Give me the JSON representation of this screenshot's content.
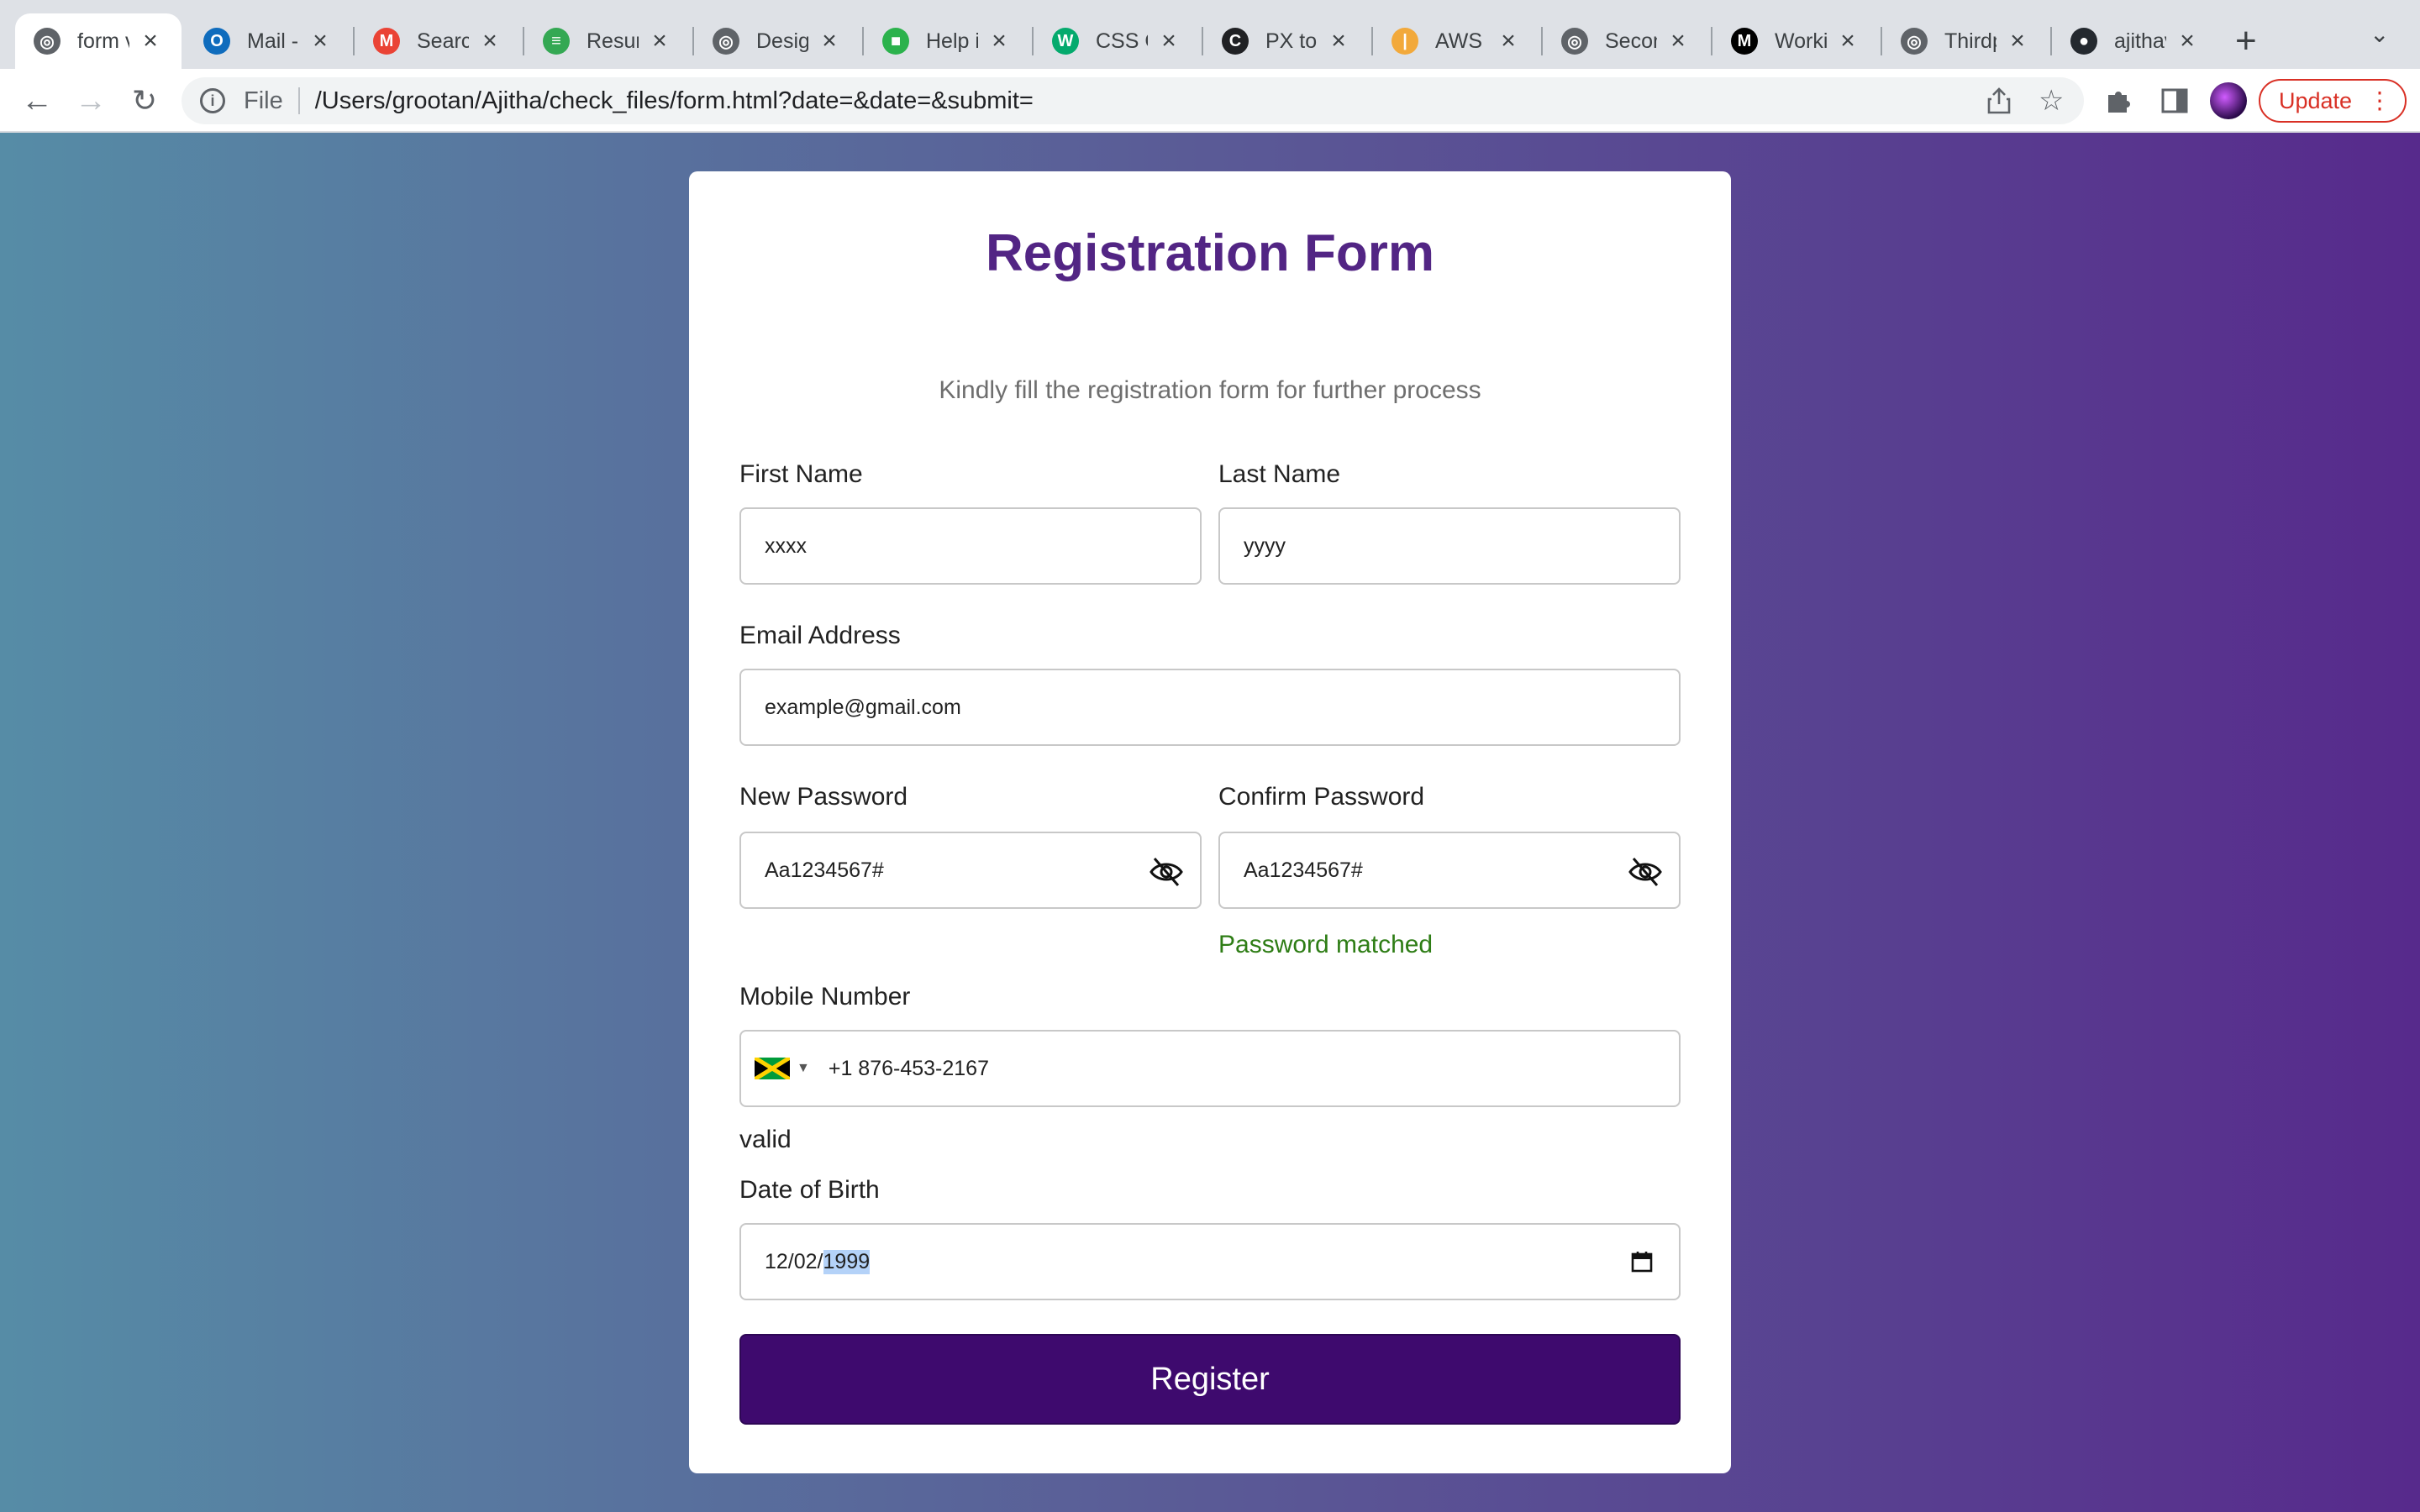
{
  "browser": {
    "tabs": [
      {
        "title": "form v",
        "icon": "globe-icon",
        "color": "#5f6368",
        "active": true
      },
      {
        "title": "Mail -",
        "icon": "outlook-icon",
        "color": "#0f6cbd"
      },
      {
        "title": "Search",
        "icon": "gmail-icon",
        "color": "#ea4335"
      },
      {
        "title": "Resum",
        "icon": "sheets-icon",
        "color": "#34a853"
      },
      {
        "title": "Design",
        "icon": "globe-icon",
        "color": "#5f6368"
      },
      {
        "title": "Help ic",
        "icon": "iconscout-icon",
        "color": "#2bb24c"
      },
      {
        "title": "CSS O",
        "icon": "w3schools-icon",
        "color": "#04aa6d"
      },
      {
        "title": "PX to I",
        "icon": "converter-icon",
        "color": "#202124"
      },
      {
        "title": "AWS I/",
        "icon": "aws-icon",
        "color": "#f2a93b"
      },
      {
        "title": "Secon",
        "icon": "globe-icon",
        "color": "#5f6368"
      },
      {
        "title": "Workir",
        "icon": "medium-icon",
        "color": "#000000"
      },
      {
        "title": "Thirdp",
        "icon": "globe-icon",
        "color": "#5f6368"
      },
      {
        "title": "ajithav",
        "icon": "github-icon",
        "color": "#24292f"
      }
    ],
    "new_tab": "+",
    "scheme_label": "File",
    "url": "/Users/grootan/Ajitha/check_files/form.html?date=&date=&submit=",
    "update_label": "Update"
  },
  "form": {
    "title": "Registration Form",
    "subtitle": "Kindly fill the registration form for further process",
    "first_name": {
      "label": "First Name",
      "value": "xxxx"
    },
    "last_name": {
      "label": "Last Name",
      "value": "yyyy"
    },
    "email": {
      "label": "Email Address",
      "value": "example@gmail.com"
    },
    "new_password": {
      "label": "New Password",
      "value": "Aa1234567#"
    },
    "confirm_password": {
      "label": "Confirm Password",
      "value": "Aa1234567#"
    },
    "password_status": "Password matched",
    "mobile": {
      "label": "Mobile Number",
      "value": "+1 876-453-2167",
      "country_flag": "jamaica-flag-icon"
    },
    "mobile_status": "valid",
    "dob": {
      "label": "Date of Birth",
      "month_day": "12/02/",
      "year": "1999"
    },
    "register_label": "Register"
  },
  "colors": {
    "title": "#522584",
    "button": "#3e0a6e",
    "success": "#2e7d15",
    "background_start": "#568ca6",
    "background_end": "#572a8c"
  }
}
